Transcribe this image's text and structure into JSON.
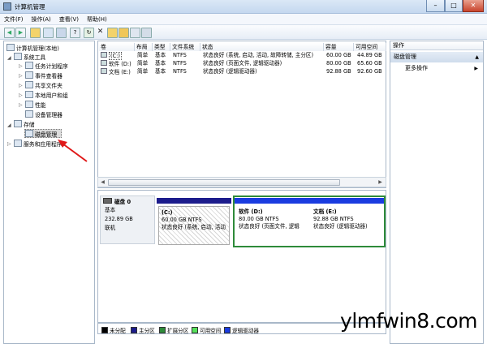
{
  "window": {
    "title": "计算机管理",
    "minimize": "–",
    "maximize": "□",
    "close": "✕"
  },
  "menu": [
    "文件(F)",
    "操作(A)",
    "查看(V)",
    "帮助(H)"
  ],
  "tree": {
    "root": "计算机管理(本地)",
    "items": [
      "系统工具",
      "任务计划程序",
      "事件查看器",
      "共享文件夹",
      "本地用户和组",
      "性能",
      "设备管理器",
      "存储",
      "磁盘管理",
      "服务和应用程序"
    ]
  },
  "volumes": {
    "headers": [
      "卷",
      "布局",
      "类型",
      "文件系统",
      "状态",
      "容量",
      "可用空间"
    ],
    "rows": [
      [
        "(C:)",
        "简单",
        "基本",
        "NTFS",
        "状态良好 (系统, 启动, 活动, 故障转储, 主分区)",
        "60.00 GB",
        "44.89 GB"
      ],
      [
        "软件 (D:)",
        "简单",
        "基本",
        "NTFS",
        "状态良好 (页面文件, 逻辑驱动器)",
        "80.00 GB",
        "65.60 GB"
      ],
      [
        "文档 (E:)",
        "简单",
        "基本",
        "NTFS",
        "状态良好 (逻辑驱动器)",
        "92.88 GB",
        "92.60 GB"
      ]
    ]
  },
  "disk": {
    "name": "磁盘 0",
    "type": "基本",
    "size": "232.89 GB",
    "status": "联机",
    "partitions": [
      {
        "label": "(C:)",
        "size": "60.00 GB NTFS",
        "status": "状态良好 (系统, 启动, 活动"
      },
      {
        "label": "软件  (D:)",
        "size": "80.00 GB NTFS",
        "status": "状态良好 (页面文件, 逻辑"
      },
      {
        "label": "文档  (E:)",
        "size": "92.88 GB NTFS",
        "status": "状态良好 (逻辑驱动器)"
      }
    ]
  },
  "legend": [
    {
      "label": "未分配",
      "color": "#000000"
    },
    {
      "label": "主分区",
      "color": "#1c1c8c"
    },
    {
      "label": "扩展分区",
      "color": "#2e8b3a"
    },
    {
      "label": "可用空间",
      "color": "#55e05a"
    },
    {
      "label": "逻辑驱动器",
      "color": "#1a3ce0"
    }
  ],
  "actions": {
    "title": "操作",
    "section": "磁盘管理",
    "more": "更多操作"
  },
  "watermark": "ylmfwin8.com"
}
